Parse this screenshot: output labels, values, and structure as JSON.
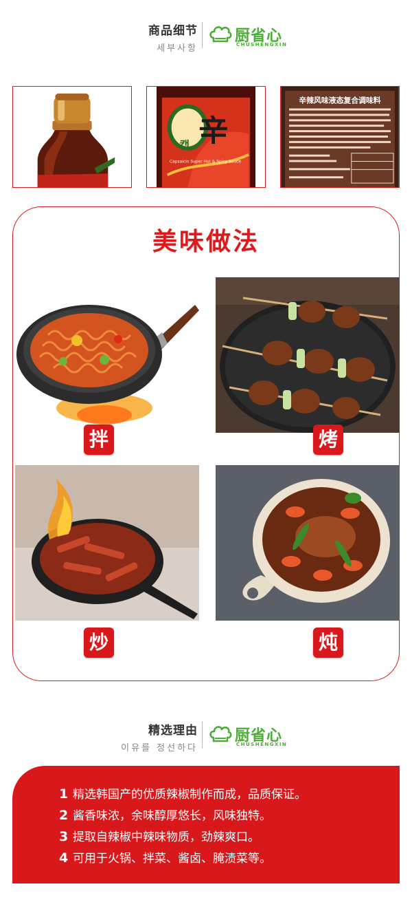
{
  "header_details": {
    "title_zh": "商品细节",
    "title_ko": "세부사항"
  },
  "brand": {
    "name": "厨省心",
    "sub": "CHUSHENGXIN",
    "color": "#4aae35"
  },
  "thumbnails": [
    {
      "name": "bottle-cap"
    },
    {
      "name": "bottle-label"
    },
    {
      "name": "ingredient-label",
      "label_title": "辛辣风味液态复合调味料"
    }
  ],
  "cooking": {
    "title": "美味做法",
    "items": [
      {
        "method": "拌",
        "dish": "spicy-noodles"
      },
      {
        "method": "烤",
        "dish": "grilled-skewers"
      },
      {
        "method": "炒",
        "dish": "stir-fry-pan"
      },
      {
        "method": "炖",
        "dish": "stew-pot"
      }
    ]
  },
  "header_reasons": {
    "title_zh": "精选理由",
    "title_ko": "이유를 정선하다"
  },
  "reasons": [
    {
      "num": "1",
      "text": "精选韩国产的优质辣椒制作而成，品质保证。"
    },
    {
      "num": "2",
      "text": "酱香味浓，余味醇厚悠长，风味独特。"
    },
    {
      "num": "3",
      "text": "提取自辣椒中辣味物质，劲辣爽口。"
    },
    {
      "num": "4",
      "text": "可用于火锅、拌菜、酱卤、腌渍菜等。"
    }
  ],
  "colors": {
    "accent_red": "#d8181c",
    "brand_green": "#4aae35"
  }
}
